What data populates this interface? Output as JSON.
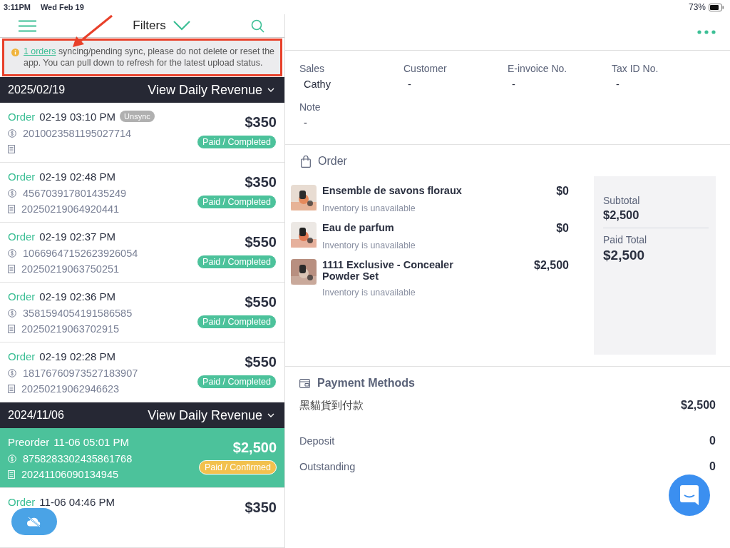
{
  "status_bar": {
    "time": "3:11PM",
    "date": "Wed Feb 19",
    "battery": "73%"
  },
  "header": {
    "title": "Filters"
  },
  "notice": {
    "text": "syncing/pending sync, please do not delete or reset the app. You can pull down to refresh for the latest upload status.",
    "link": "1 orders"
  },
  "groups": [
    {
      "date": "2025/02/19",
      "action": "View Daily Revenue",
      "orders": [
        {
          "type": "Order",
          "time": "02-19 03:10 PM",
          "unsync": "Unsync",
          "payment_no": "2010023581195027714",
          "amount": "$350",
          "status": "Paid / Completed",
          "color": "#4cc29b",
          "selected": false
        },
        {
          "type": "Order",
          "time": "02-19 02:48 PM",
          "payment_no": "456703917801435249",
          "invoice_no": "20250219064920441",
          "amount": "$350",
          "status": "Paid / Completed",
          "color": "#4cc29b",
          "selected": false
        },
        {
          "type": "Order",
          "time": "02-19 02:37 PM",
          "payment_no": "10669647152623926054",
          "invoice_no": "20250219063750251",
          "amount": "$550",
          "status": "Paid / Completed",
          "color": "#4cc29b",
          "selected": false
        },
        {
          "type": "Order",
          "time": "02-19 02:36 PM",
          "payment_no": "3581594054191586585",
          "invoice_no": "20250219063702915",
          "amount": "$550",
          "status": "Paid / Completed",
          "color": "#4cc29b",
          "selected": false
        },
        {
          "type": "Order",
          "time": "02-19 02:28 PM",
          "payment_no": "18176760973527183907",
          "invoice_no": "20250219062946623",
          "amount": "$550",
          "status": "Paid / Completed",
          "color": "#4cc29b",
          "selected": false
        }
      ]
    },
    {
      "date": "2024/11/06",
      "action": "View Daily Revenue",
      "orders": [
        {
          "type": "Preorder",
          "time": "11-06 05:01 PM",
          "payment_no": "8758283302435861768",
          "invoice_no": "20241106090134945",
          "amount": "$2,500",
          "status": "Paid / Confirmed",
          "color": "#f2c14e",
          "selected": true
        },
        {
          "type": "Order",
          "time": "11-06 04:46 PM",
          "amount": "$350",
          "selected": false
        }
      ]
    }
  ],
  "details": [
    {
      "label": "Sales",
      "value": "Cathy"
    },
    {
      "label": "Customer",
      "value": "-"
    },
    {
      "label": "E-invoice No.",
      "value": "-"
    },
    {
      "label": "Tax ID No.",
      "value": "-"
    },
    {
      "label": "Note",
      "value": "-"
    }
  ],
  "order": {
    "title": "Order",
    "items": [
      {
        "name": "Ensemble de savons floraux",
        "price": "$0",
        "note": "Inventory is unavailable"
      },
      {
        "name": "Eau de parfum",
        "price": "$0",
        "note": "Inventory is unavailable"
      },
      {
        "name": "1111 Exclusive - Concealer Powder Set",
        "price": "$2,500",
        "note": "Inventory is unavailable"
      }
    ],
    "summary": [
      {
        "label": "Subtotal",
        "value": "$2,500"
      },
      {
        "label": "Paid Total",
        "value": "$2,500"
      }
    ]
  },
  "payment": {
    "title": "Payment Methods",
    "rows": [
      {
        "label": "黑貓貨到付款",
        "value": "$2,500"
      },
      {
        "label": "Deposit",
        "value": "0"
      },
      {
        "label": "Outstanding",
        "value": "0"
      }
    ]
  }
}
